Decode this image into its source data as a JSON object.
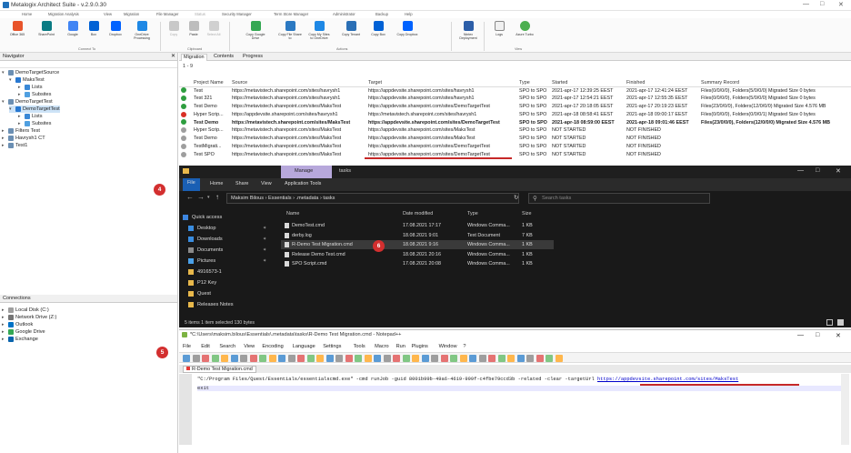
{
  "window": {
    "title": "Metalogix Architect Suite - v.2.9.0.30"
  },
  "menu": [
    "Home",
    "Migration Analysis",
    "View",
    "Migration",
    "File Manager",
    "Status",
    "Security Manager",
    "Term Store Manager",
    "Administrator",
    "Backup",
    "Help"
  ],
  "ribbon": {
    "buttons": [
      "Office 365",
      "SharePoint",
      "Google",
      "Box",
      "Dropbox",
      "OneDrive Processing",
      "Copy",
      "Paste",
      "Select All",
      "Copy Google Drive",
      "Copy File Share to",
      "Copy My Sites to OneDrive",
      "Copy Tenant",
      "Copy Box",
      "Copy Dropbox",
      "Nintex Deployment",
      "Logs",
      "Azure Turbo"
    ],
    "groups": [
      "Connect To",
      "Clipboard",
      "Actions",
      "View"
    ]
  },
  "navigator": {
    "title": "Navigator",
    "tree": [
      {
        "label": "DemoTargetSource",
        "level": 0
      },
      {
        "label": "MaksTest",
        "level": 1
      },
      {
        "label": "Lists",
        "level": 2
      },
      {
        "label": "Subsites",
        "level": 2
      },
      {
        "label": "DemoTargetTest",
        "level": 0
      },
      {
        "label": "DemoTargetTest",
        "level": 1
      },
      {
        "label": "Lists",
        "level": 2
      },
      {
        "label": "Subsites",
        "level": 2
      },
      {
        "label": "Filters Test",
        "level": 0
      },
      {
        "label": "Havrysh1 CT",
        "level": 0
      },
      {
        "label": "Test1",
        "level": 0
      }
    ]
  },
  "connections": {
    "title": "Connections",
    "items": [
      "Local Disk (C:)",
      "Network Drive (Z:)",
      "Outlook",
      "Google Drive",
      "Exchange"
    ]
  },
  "migration": {
    "tabs": [
      "Migration",
      "Contents",
      "Progress"
    ],
    "pager": "1 - 9",
    "columns": [
      "Project Name",
      "Source",
      "Target",
      "Type",
      "Started",
      "Finished",
      "Summary Record"
    ],
    "rows": [
      {
        "status": "success",
        "name": "Test",
        "source": "https://metavistech.sharepoint.com/sites/havrysh1",
        "target": "https://appdevsite.sharepoint.com/sites/havrysh1",
        "type": "SPO to SPO",
        "started": "2021-apr-17 12:39:25 EEST",
        "finished": "2021-apr-17 12:41:24 EEST",
        "summary": "Files(0/0/0/0), Folders(5/0/0/0) Migrated Size 0 bytes"
      },
      {
        "status": "success",
        "name": "Test 321",
        "source": "https://metavistech.sharepoint.com/sites/havrysh1",
        "target": "https://appdevsite.sharepoint.com/sites/havrysh1",
        "type": "SPO to SPO",
        "started": "2021-apr-17 12:54:21 EEST",
        "finished": "2021-apr-17 12:55:35 EEST",
        "summary": "Files(0/0/0/0), Folders(5/0/0/0) Migrated Size 0 bytes"
      },
      {
        "status": "success",
        "name": "Test Demo",
        "source": "https://metavistech.sharepoint.com/sites/MaksTest",
        "target": "https://appdevsite.sharepoint.com/sites/DemoTargetTest",
        "type": "SPO to SPO",
        "started": "2021-apr-17 20:18:05 EEST",
        "finished": "2021-apr-17 20:19:23 EEST",
        "summary": "Files(23/0/0/0), Folders(12/0/0/0) Migrated Size 4.576 MB"
      },
      {
        "status": "error",
        "name": "Hyper Scrip...",
        "source": "https://appdevsite.sharepoint.com/sites/havrysh1",
        "target": "https://metavistech.sharepoint.com/sites/havrysh1",
        "type": "SPO to SPO",
        "started": "2021-apr-18 08:58:41 EEST",
        "finished": "2021-apr-18 09:00:17 EEST",
        "summary": "Files(0/0/0/0), Folders(0/0/0/1) Migrated Size 0 bytes"
      },
      {
        "status": "success",
        "name": "Test Demo",
        "source": "https://metavistech.sharepoint.com/sites/MaksTest",
        "target": "https://appdevsite.sharepoint.com/sites/DemoTargetTest",
        "type": "SPO to SPO",
        "started": "2021-apr-18 08:59:00 EEST",
        "finished": "2021-apr-18 09:01:46 EEST",
        "summary": "Files(23/0/0/0), Folders(12/0/0/0) Migrated Size 4.576 MB",
        "bold": true
      },
      {
        "status": "pending",
        "name": "Hyper Scrip...",
        "source": "https://metavistech.sharepoint.com/sites/MaksTest",
        "target": "https://appdevsite.sharepoint.com/sites/MaksTest",
        "type": "SPO to SPO",
        "started": "NOT STARTED",
        "finished": "NOT FINISHED",
        "summary": ""
      },
      {
        "status": "pending",
        "name": "Test Demo",
        "source": "https://metavistech.sharepoint.com/sites/MaksTest",
        "target": "https://appdevsite.sharepoint.com/sites/MaksTest",
        "type": "SPO to SPO",
        "started": "NOT STARTED",
        "finished": "NOT FINISHED",
        "summary": ""
      },
      {
        "status": "pending",
        "name": "TestMigrati...",
        "source": "https://metavistech.sharepoint.com/sites/MaksTest",
        "target": "https://appdevsite.sharepoint.com/sites/DemoTargetTest",
        "type": "SPO to SPO",
        "started": "NOT STARTED",
        "finished": "NOT FINISHED",
        "summary": ""
      },
      {
        "status": "pending",
        "name": "Test SPO",
        "source": "https://metavistech.sharepoint.com/sites/MaksTest",
        "target": "https://appdevsite.sharepoint.com/sites/DemoTargetTest",
        "type": "SPO to SPO",
        "started": "NOT STARTED",
        "finished": "NOT FINISHED",
        "summary": ""
      }
    ]
  },
  "explorer": {
    "context_tab": "Manage",
    "title": "tasks",
    "ribbon_tabs": [
      "File",
      "Home",
      "Share",
      "View",
      "Application Tools"
    ],
    "breadcrumb": [
      "Maksim Bilous",
      "Essentials",
      ".metadata",
      "tasks"
    ],
    "search_placeholder": "Search tasks",
    "quick_access": [
      "Quick access",
      "Desktop",
      "Downloads",
      "Documents",
      "Pictures",
      "4916573-1",
      "P12 Key",
      "Quest",
      "Releases Notes"
    ],
    "columns": [
      "Name",
      "Date modified",
      "Type",
      "Size"
    ],
    "files": [
      {
        "name": "DemoTest.cmd",
        "date": "17.08.2021 17:17",
        "type": "Windows Comma...",
        "size": "1 KB"
      },
      {
        "name": "derby.log",
        "date": "18.08.2021 9:01",
        "type": "Text Document",
        "size": "7 KB"
      },
      {
        "name": "R-Demo Test Migration.cmd",
        "date": "18.08.2021 9:16",
        "type": "Windows Comma...",
        "size": "1 KB",
        "selected": true
      },
      {
        "name": "Release Demo Test.cmd",
        "date": "18.08.2021 20:16",
        "type": "Windows Comma...",
        "size": "1 KB"
      },
      {
        "name": "SPO Script.cmd",
        "date": "17.08.2021 20:08",
        "type": "Windows Comma...",
        "size": "1 KB"
      }
    ],
    "status": "5 items   1 item selected  130 bytes"
  },
  "notepad": {
    "title": "*C:\\Users\\maksim.bilous\\Essentials\\.metadata\\tasks\\R-Demo Test Migration.cmd - Notepad++",
    "menu": [
      "File",
      "Edit",
      "Search",
      "View",
      "Encoding",
      "Language",
      "Settings",
      "Tools",
      "Macro",
      "Run",
      "Plugins",
      "Window",
      "?"
    ],
    "tab": "R-Demo Test Migration.cmd",
    "line1_prefix": "\"C:/Program Files/Quest/Essentials/essentialscmd.exe\" -cmd runJob -guid 8001b99b-49a6-4619-999f-c4fbe79ccd3b -related -clear -targetUrl",
    "line1_url": "https://appdevsite.sharepoint.com/sites/MaksTest",
    "line2": "exit"
  },
  "annotations": [
    "4",
    "5",
    "6"
  ],
  "colors": {
    "success": "#2e9e3f",
    "error": "#d93025",
    "pending": "#9e9e9e",
    "annotation": "#d32f2f"
  }
}
